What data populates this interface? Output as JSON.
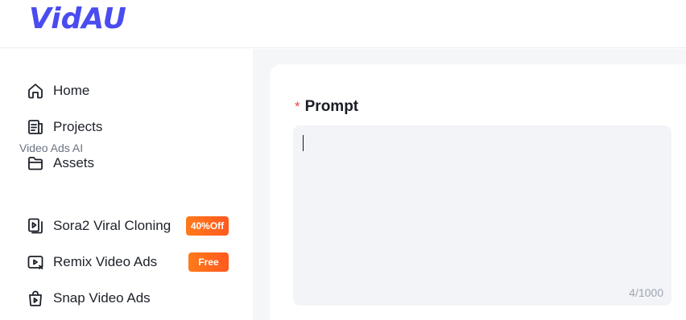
{
  "app": {
    "logo_text": "VidAU",
    "brand_color": "#4a4cf0"
  },
  "sidebar": {
    "items": [
      {
        "label": "Home",
        "icon": "home-icon"
      },
      {
        "label": "Projects",
        "icon": "projects-icon"
      },
      {
        "label": "Assets",
        "icon": "folder-icon"
      }
    ],
    "section_title": "Video Ads AI",
    "ai_items": [
      {
        "label": "Sora2 Viral Cloning",
        "icon": "video-clone-icon",
        "badge": "40%Off"
      },
      {
        "label": "Remix Video Ads",
        "icon": "remix-video-icon",
        "badge": "Free"
      },
      {
        "label": "Snap Video Ads",
        "icon": "snap-bag-icon"
      }
    ],
    "badge_color": "#ff6a1f"
  },
  "main": {
    "prompt": {
      "required_marker": "*",
      "label": "Prompt",
      "value": "",
      "counter": "4/1000"
    }
  }
}
